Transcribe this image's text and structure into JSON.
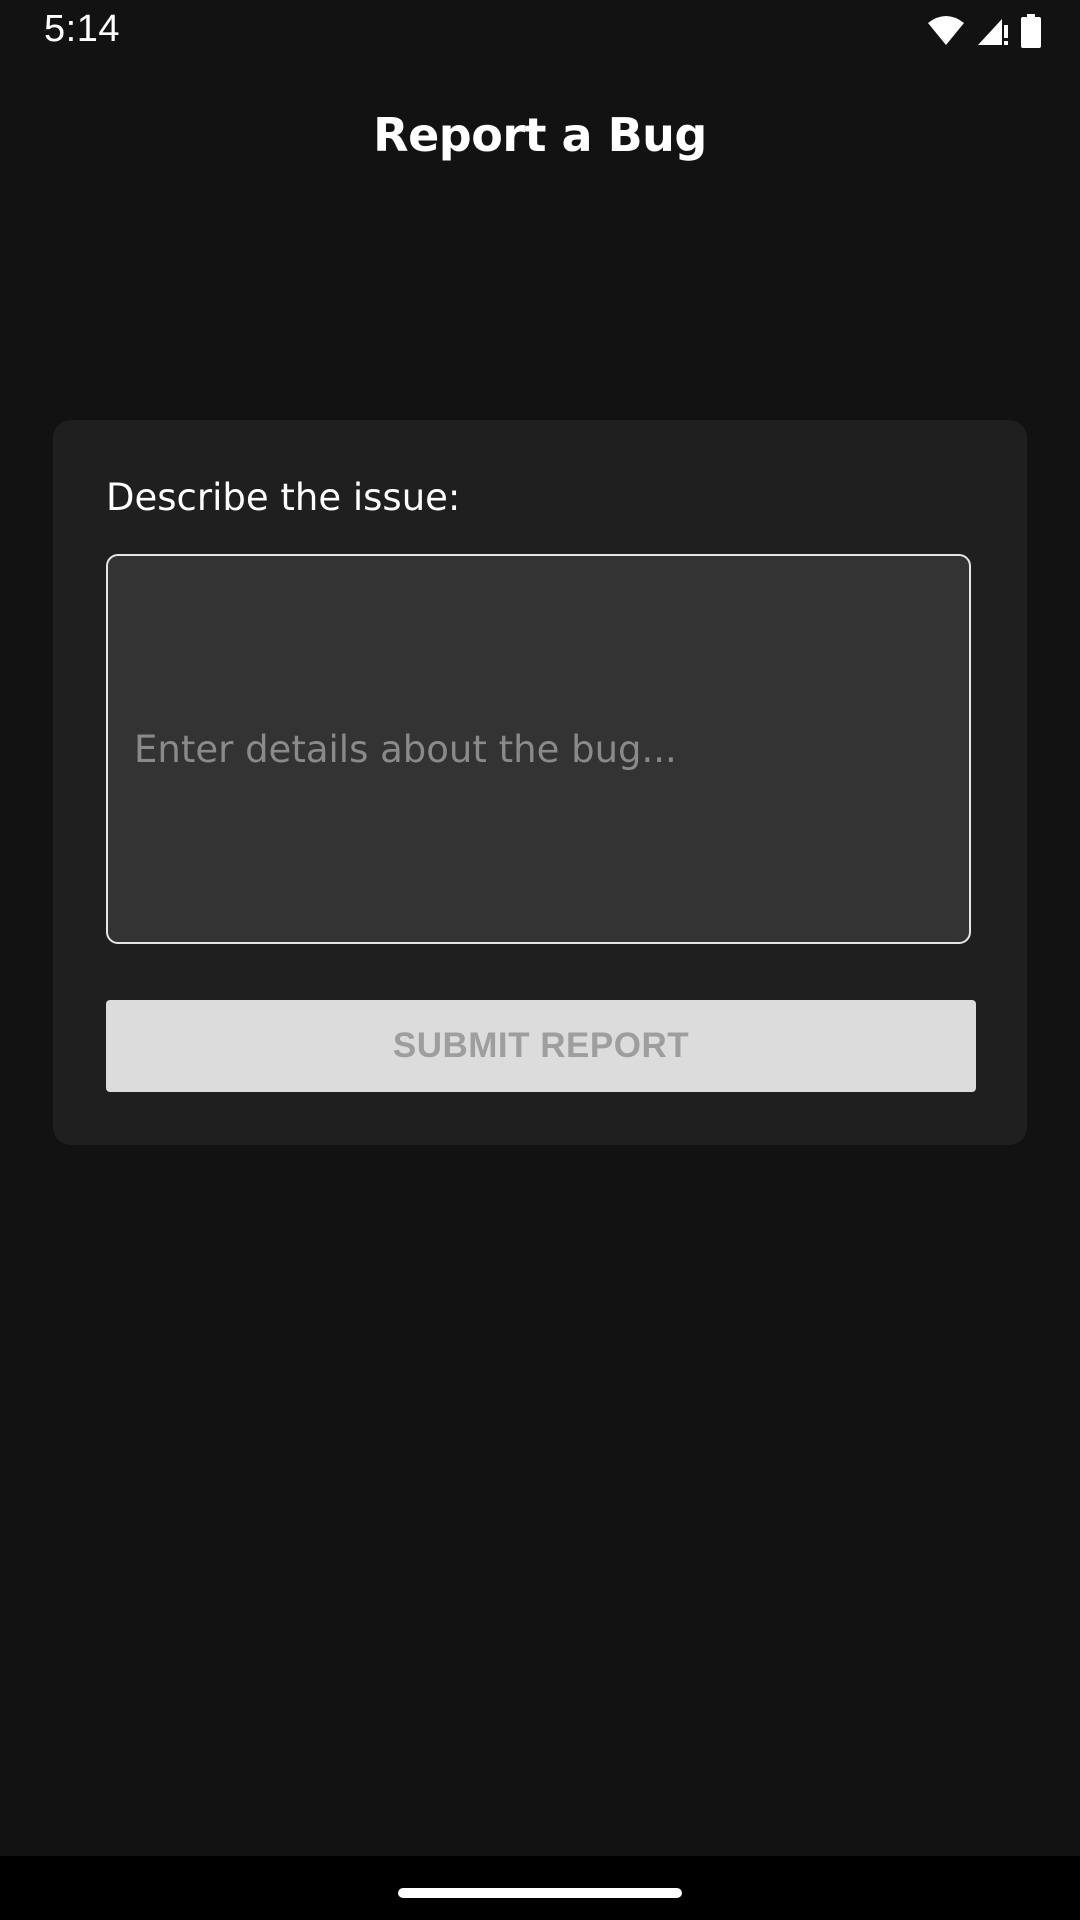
{
  "status_bar": {
    "time": "5:14",
    "icons": [
      "wifi-icon",
      "signal-icon",
      "battery-icon"
    ]
  },
  "header": {
    "title": "Report a Bug"
  },
  "form": {
    "label": "Describe the issue:",
    "input_placeholder": "Enter details about the bug...",
    "input_value": "",
    "submit_label": "SUBMIT REPORT"
  },
  "colors": {
    "background": "#121212",
    "card": "#1f1f1f",
    "input_background": "#333333",
    "button_disabled": "#dcdcdc",
    "button_text_disabled": "#9e9e9e"
  }
}
